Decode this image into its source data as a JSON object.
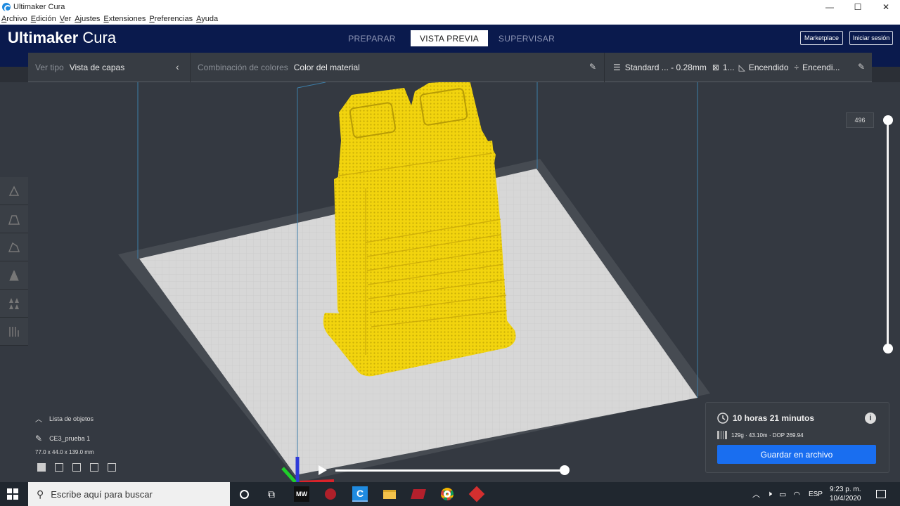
{
  "window": {
    "title": "Ultimaker Cura",
    "minimize": "—",
    "maximize": "☐",
    "close": "✕"
  },
  "menu": {
    "items": [
      "Archivo",
      "Edición",
      "Ver",
      "Ajustes",
      "Extensiones",
      "Preferencias",
      "Ayuda"
    ]
  },
  "header": {
    "brand_bold": "Ultimaker",
    "brand_light": "Cura",
    "tabs": [
      {
        "label": "PREPARAR",
        "active": false
      },
      {
        "label": "VISTA PREVIA",
        "active": true
      },
      {
        "label": "SUPERVISAR",
        "active": false
      }
    ],
    "marketplace": "Marketplace",
    "signin": "Iniciar sesión"
  },
  "viewpanel": {
    "view_type_label": "Ver tipo",
    "view_type_value": "Vista de capas",
    "color_scheme_label": "Combinación de colores",
    "color_scheme_value": "Color del material",
    "profile": "Standard ... - 0.28mm",
    "infill": "1...",
    "support": "Encendido",
    "adhesion": "Encendi..."
  },
  "layer_slider": {
    "current_layer": "496"
  },
  "object_list": {
    "toggle_label": "Lista de objetos",
    "object_name": "CE3_prueba 1",
    "dimensions": "77.0 x 44.0 x 139.0 mm"
  },
  "playback": {
    "progress": 1.0
  },
  "print_info": {
    "duration": "10 horas 21 minutos",
    "material": "129g · 43.10m · DOP 269.94",
    "save_label": "Guardar en archivo",
    "info_glyph": "i"
  },
  "taskbar": {
    "search_placeholder": "Escribe aquí para buscar",
    "language": "ESP",
    "time": "9:23 p. m.",
    "date": "10/4/2020"
  },
  "colors": {
    "header_bg": "#0a1a4d",
    "viewport_bg": "#343941",
    "model_yellow": "#f5d90a",
    "accent_blue": "#196ef0"
  }
}
